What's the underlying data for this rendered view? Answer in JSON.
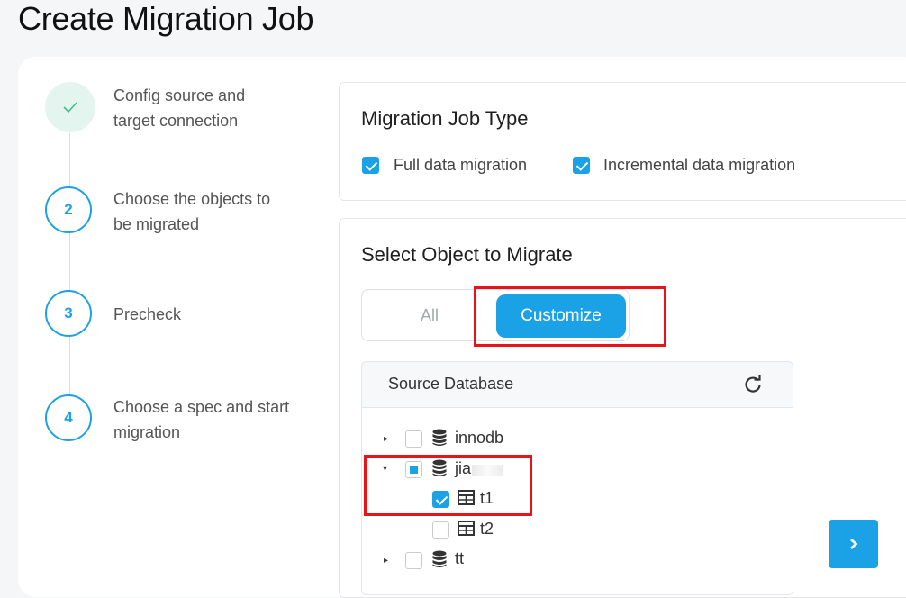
{
  "page": {
    "title": "Create Migration Job"
  },
  "steps": [
    {
      "number": "",
      "label_line1": "Config source and",
      "label_line2": "target connection",
      "status": "done"
    },
    {
      "number": "2",
      "label_line1": "Choose the objects to",
      "label_line2": "be migrated",
      "status": "pending"
    },
    {
      "number": "3",
      "label_line1": "Precheck",
      "label_line2": "",
      "status": "pending"
    },
    {
      "number": "4",
      "label_line1": "Choose a spec and start",
      "label_line2": "migration",
      "status": "pending"
    }
  ],
  "job_type": {
    "title": "Migration Job Type",
    "options": [
      {
        "label": "Full data migration",
        "checked": true
      },
      {
        "label": "Incremental data migration",
        "checked": true
      }
    ]
  },
  "select_object": {
    "title": "Select Object to Migrate",
    "modes": {
      "all": "All",
      "customize": "Customize",
      "selected": "Customize"
    }
  },
  "source_db": {
    "title": "Source Database",
    "refresh_icon": "refresh-icon",
    "tree": [
      {
        "name": "innodb",
        "type": "database",
        "expanded": false,
        "check_state": "unchecked"
      },
      {
        "name": "jia",
        "type": "database",
        "expanded": true,
        "check_state": "partial",
        "children": [
          {
            "name": "t1",
            "type": "table",
            "check_state": "checked"
          },
          {
            "name": "t2",
            "type": "table",
            "check_state": "unchecked"
          }
        ]
      },
      {
        "name": "tt",
        "type": "database",
        "expanded": false,
        "check_state": "unchecked"
      }
    ]
  },
  "colors": {
    "accent": "#1aa1e6",
    "highlight": "#e8141a",
    "done_step_bg": "#e3f5ee",
    "done_check": "#3fbf8a"
  }
}
